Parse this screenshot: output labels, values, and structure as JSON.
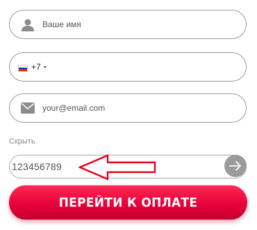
{
  "form": {
    "name_placeholder": "Ваше имя",
    "name_icon": "user-icon",
    "phone_country": "RU",
    "phone_code": "+7",
    "email_placeholder": "your@email.com",
    "email_icon": "mail-icon",
    "hide_label": "Скрыть",
    "promo_value": "123456789",
    "submit_label": "ПЕРЕЙТИ К ОПЛАТЕ"
  },
  "colors": {
    "accent": "#e8003a",
    "annotation_arrow": "#e3001b",
    "apply_button": "#9b9b9b",
    "border": "#9a9a9a"
  }
}
